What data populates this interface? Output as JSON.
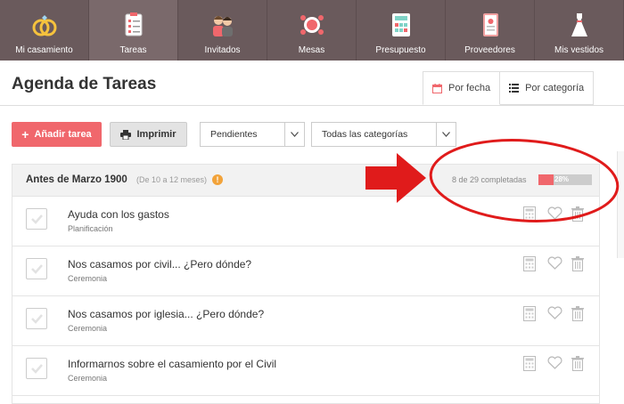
{
  "nav": {
    "items": [
      {
        "label": "Mi casamiento",
        "icon": "rings-icon"
      },
      {
        "label": "Tareas",
        "icon": "checklist-icon"
      },
      {
        "label": "Invitados",
        "icon": "guests-icon"
      },
      {
        "label": "Mesas",
        "icon": "tables-icon"
      },
      {
        "label": "Presupuesto",
        "icon": "budget-icon"
      },
      {
        "label": "Proveedores",
        "icon": "providers-icon"
      },
      {
        "label": "Mis vestidos",
        "icon": "dress-icon"
      }
    ],
    "active_index": 1
  },
  "header": {
    "title": "Agenda de Tareas",
    "tab_by_date": "Por fecha",
    "tab_by_category": "Por categoría"
  },
  "toolbar": {
    "add_label": "Añadir tarea",
    "print_label": "Imprimir",
    "status_select": "Pendientes",
    "category_select": "Todas las categorías"
  },
  "group": {
    "title": "Antes de Marzo 1900",
    "subtitle": "(De 10 a 12 meses)",
    "warning_symbol": "!",
    "progress_text": "8 de 29 completadas",
    "progress_percent_label": "28%",
    "progress_fraction": 0.28
  },
  "tasks": [
    {
      "name": "Ayuda con los gastos",
      "category": "Planificación"
    },
    {
      "name": "Nos casamos por civil... ¿Pero dónde?",
      "category": "Ceremonia"
    },
    {
      "name": "Nos casamos por iglesia... ¿Pero dónde?",
      "category": "Ceremonia"
    },
    {
      "name": "Informarnos sobre el casamiento por el Civil",
      "category": "Ceremonia"
    }
  ],
  "colors": {
    "nav_bg": "#6a5a5c",
    "accent": "#f0676c",
    "annotation_red": "#e01b1b"
  }
}
